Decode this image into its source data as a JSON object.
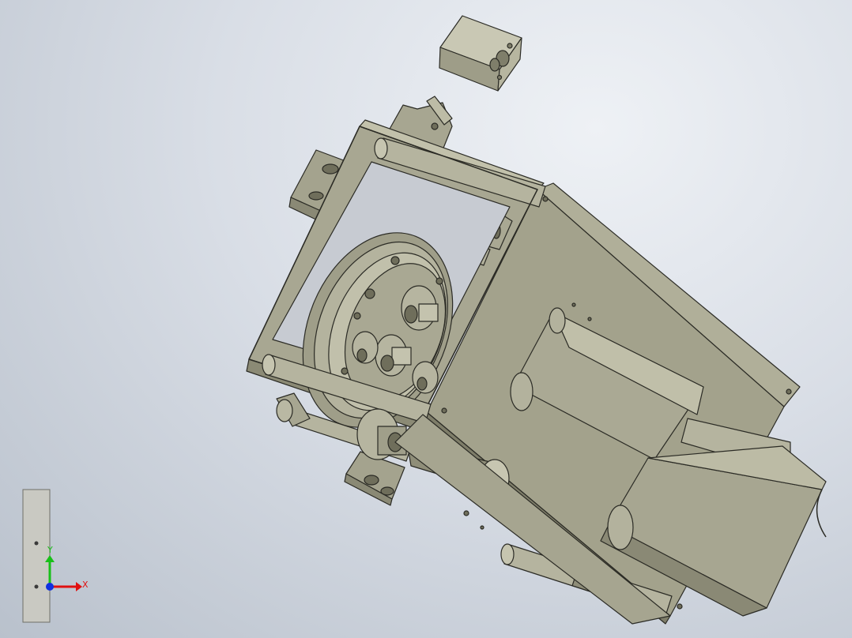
{
  "view": {
    "background_top": "#eef1f5",
    "background_bottom": "#b9c1cc",
    "model_color": "#a9a893",
    "model_shadow": "#6c6b58",
    "edge_color": "#2b2b25"
  },
  "triad": {
    "x_label": "X",
    "y_label": "Y",
    "x_color": "#e01010",
    "y_color": "#18c018",
    "z_color": "#1030e0"
  }
}
